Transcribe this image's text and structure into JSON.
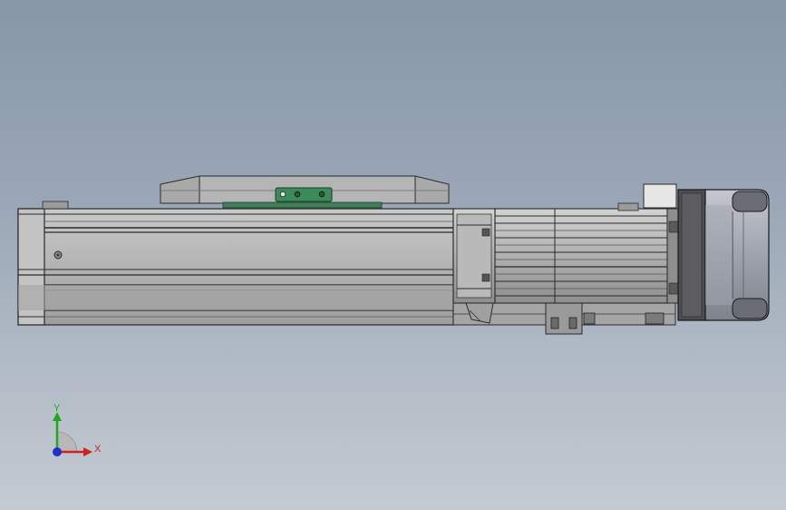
{
  "viewport": {
    "background_top": "#8797a8",
    "background_bottom": "#c3cad2"
  },
  "model": {
    "description_icon": "linear-actuator-with-stepper-motor",
    "body_color": "#b8b8b8",
    "edge_color": "#2a2a2a",
    "carriage_label_color": "#2e7d4f",
    "motor_color": "#9a9da6",
    "motor_dark_color": "#4a4a4e"
  },
  "triad": {
    "x_label": "X",
    "y_label": "Y",
    "x_color": "#d22020",
    "y_color": "#1fa81f",
    "z_color": "#2030c8"
  }
}
